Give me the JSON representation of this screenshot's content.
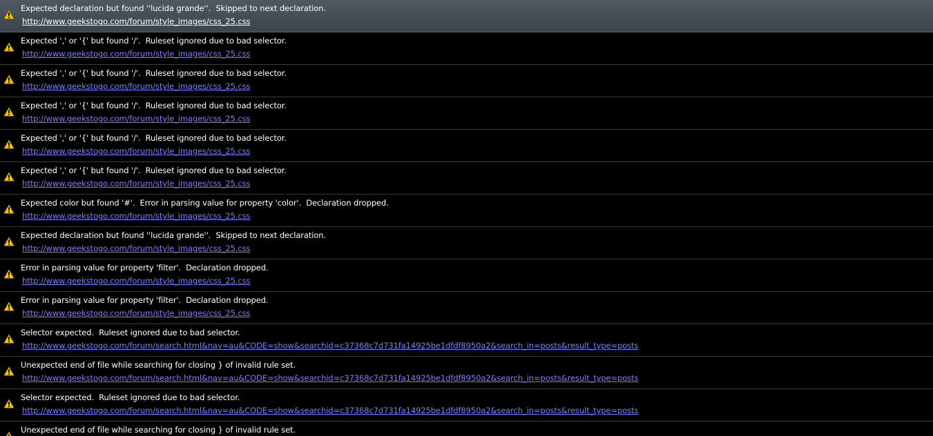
{
  "console": {
    "selected_index": 0,
    "entries": [
      {
        "icon": "warning-icon",
        "message": "Expected declaration but found ''lucida grande''.  Skipped to next declaration.",
        "source": "http://www.geekstogo.com/forum/style_images/css_25.css"
      },
      {
        "icon": "warning-icon",
        "message": "Expected ',' or '{' but found '/'.  Ruleset ignored due to bad selector.",
        "source": "http://www.geekstogo.com/forum/style_images/css_25.css"
      },
      {
        "icon": "warning-icon",
        "message": "Expected ',' or '{' but found '/'.  Ruleset ignored due to bad selector.",
        "source": "http://www.geekstogo.com/forum/style_images/css_25.css"
      },
      {
        "icon": "warning-icon",
        "message": "Expected ',' or '{' but found '/'.  Ruleset ignored due to bad selector.",
        "source": "http://www.geekstogo.com/forum/style_images/css_25.css"
      },
      {
        "icon": "warning-icon",
        "message": "Expected ',' or '{' but found '/'.  Ruleset ignored due to bad selector.",
        "source": "http://www.geekstogo.com/forum/style_images/css_25.css"
      },
      {
        "icon": "warning-icon",
        "message": "Expected ',' or '{' but found '/'.  Ruleset ignored due to bad selector.",
        "source": "http://www.geekstogo.com/forum/style_images/css_25.css"
      },
      {
        "icon": "warning-icon",
        "message": "Expected color but found '#'.  Error in parsing value for property 'color'.  Declaration dropped.",
        "source": "http://www.geekstogo.com/forum/style_images/css_25.css"
      },
      {
        "icon": "warning-icon",
        "message": "Expected declaration but found ''lucida grande''.  Skipped to next declaration.",
        "source": "http://www.geekstogo.com/forum/style_images/css_25.css"
      },
      {
        "icon": "warning-icon",
        "message": "Error in parsing value for property 'filter'.  Declaration dropped.",
        "source": "http://www.geekstogo.com/forum/style_images/css_25.css"
      },
      {
        "icon": "warning-icon",
        "message": "Error in parsing value for property 'filter'.  Declaration dropped.",
        "source": "http://www.geekstogo.com/forum/style_images/css_25.css"
      },
      {
        "icon": "warning-icon",
        "message": "Selector expected.  Ruleset ignored due to bad selector.",
        "source": "http://www.geekstogo.com/forum/search.html&nav=au&CODE=show&searchid=c37368c7d731fa14925be1dfdf8950a2&search_in=posts&result_type=posts"
      },
      {
        "icon": "warning-icon",
        "message": "Unexpected end of file while searching for closing } of invalid rule set.",
        "source": "http://www.geekstogo.com/forum/search.html&nav=au&CODE=show&searchid=c37368c7d731fa14925be1dfdf8950a2&search_in=posts&result_type=posts"
      },
      {
        "icon": "warning-icon",
        "message": "Selector expected.  Ruleset ignored due to bad selector.",
        "source": "http://www.geekstogo.com/forum/search.html&nav=au&CODE=show&searchid=c37368c7d731fa14925be1dfdf8950a2&search_in=posts&result_type=posts"
      },
      {
        "icon": "warning-icon",
        "message": "Unexpected end of file while searching for closing } of invalid rule set.",
        "source": ""
      }
    ]
  },
  "colors": {
    "background": "#000000",
    "selected_row": "#444d55",
    "separator": "#3a3a3a",
    "message_text": "#ffffff",
    "link": "#7d7dff",
    "warning_fill": "#f5c400"
  }
}
